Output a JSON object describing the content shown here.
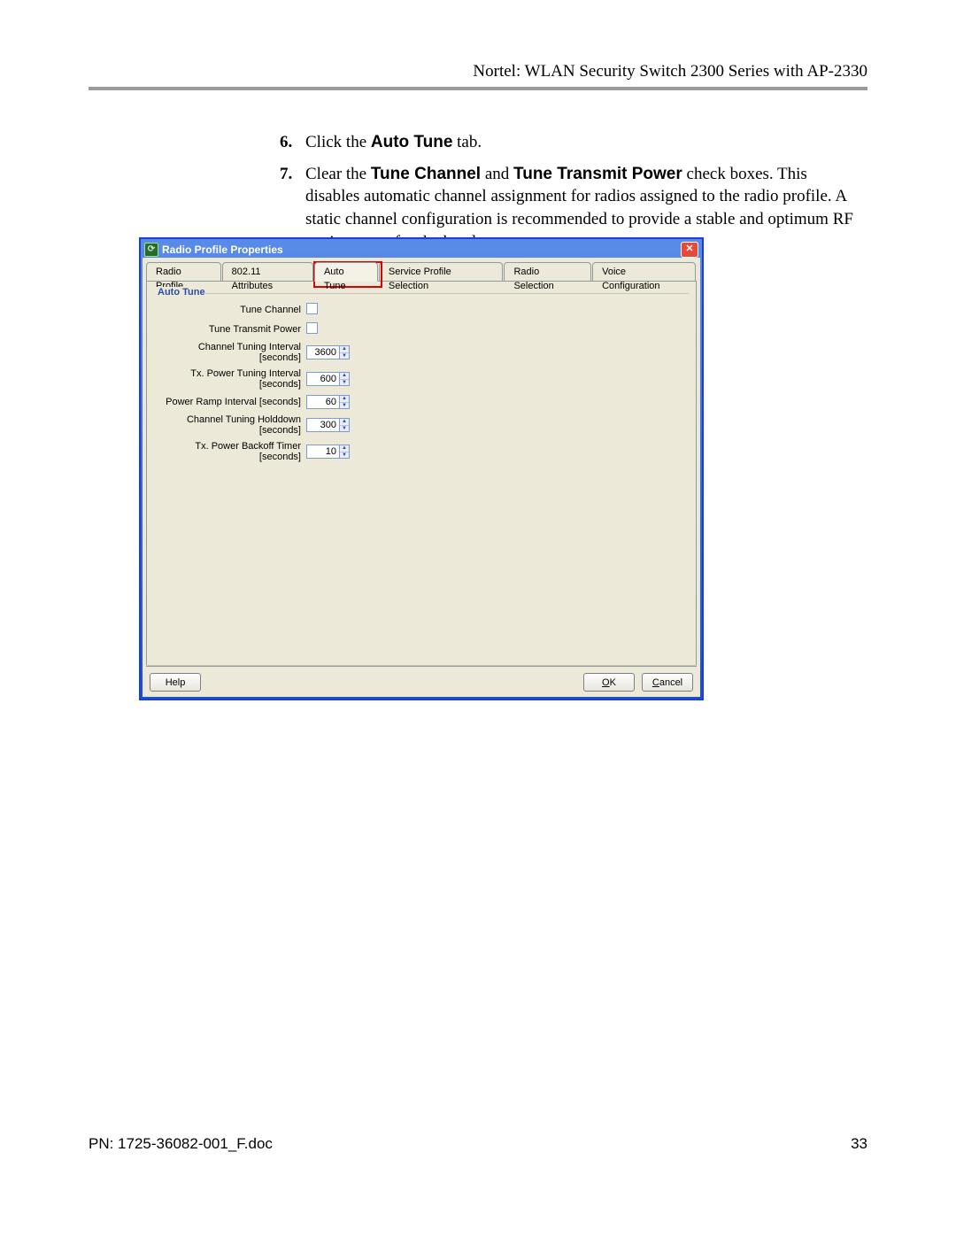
{
  "header": {
    "title": "Nortel: WLAN Security Switch 2300 Series with AP-2330"
  },
  "instructions": {
    "start_number": 6,
    "items": [
      {
        "num": "6.",
        "html_parts": [
          "Click the ",
          {
            "b": "Auto Tune"
          },
          " tab."
        ]
      },
      {
        "num": "7.",
        "html_parts": [
          "Clear the ",
          {
            "b": "Tune Channel"
          },
          " and ",
          {
            "b": "Tune Transmit Power"
          },
          " check boxes. This disables automatic channel assignment for radios assigned to the radio profile. A static channel configuration is recommended to provide a stable and optimum RF environment for the handsets."
        ]
      }
    ]
  },
  "dialog": {
    "title": "Radio Profile Properties",
    "close_glyph": "✕",
    "tabs": [
      {
        "label": "Radio Profile",
        "active": false
      },
      {
        "label": "802.11 Attributes",
        "active": false
      },
      {
        "label": "Auto Tune",
        "active": true,
        "highlight": true
      },
      {
        "label": "Service Profile Selection",
        "active": false
      },
      {
        "label": "Radio Selection",
        "active": false
      },
      {
        "label": "Voice Configuration",
        "active": false
      }
    ],
    "group": {
      "title": "Auto Tune",
      "rows": [
        {
          "label": "Tune Channel",
          "type": "checkbox",
          "checked": false
        },
        {
          "label": "Tune Transmit Power",
          "type": "checkbox",
          "checked": false
        },
        {
          "label": "Channel Tuning Interval [seconds]",
          "type": "spin",
          "value": "3600"
        },
        {
          "label": "Tx. Power Tuning Interval [seconds]",
          "type": "spin",
          "value": "600"
        },
        {
          "label": "Power Ramp Interval [seconds]",
          "type": "spin",
          "value": "60"
        },
        {
          "label": "Channel Tuning Holddown [seconds]",
          "type": "spin",
          "value": "300"
        },
        {
          "label": "Tx. Power Backoff Timer [seconds]",
          "type": "spin",
          "value": "10"
        }
      ]
    },
    "buttons": {
      "help": "Help",
      "ok_u": "O",
      "ok_rest": "K",
      "cancel_u": "C",
      "cancel_rest": "ancel"
    }
  },
  "page_footer": {
    "left": "PN: 1725-36082-001_F.doc",
    "right": "33"
  }
}
